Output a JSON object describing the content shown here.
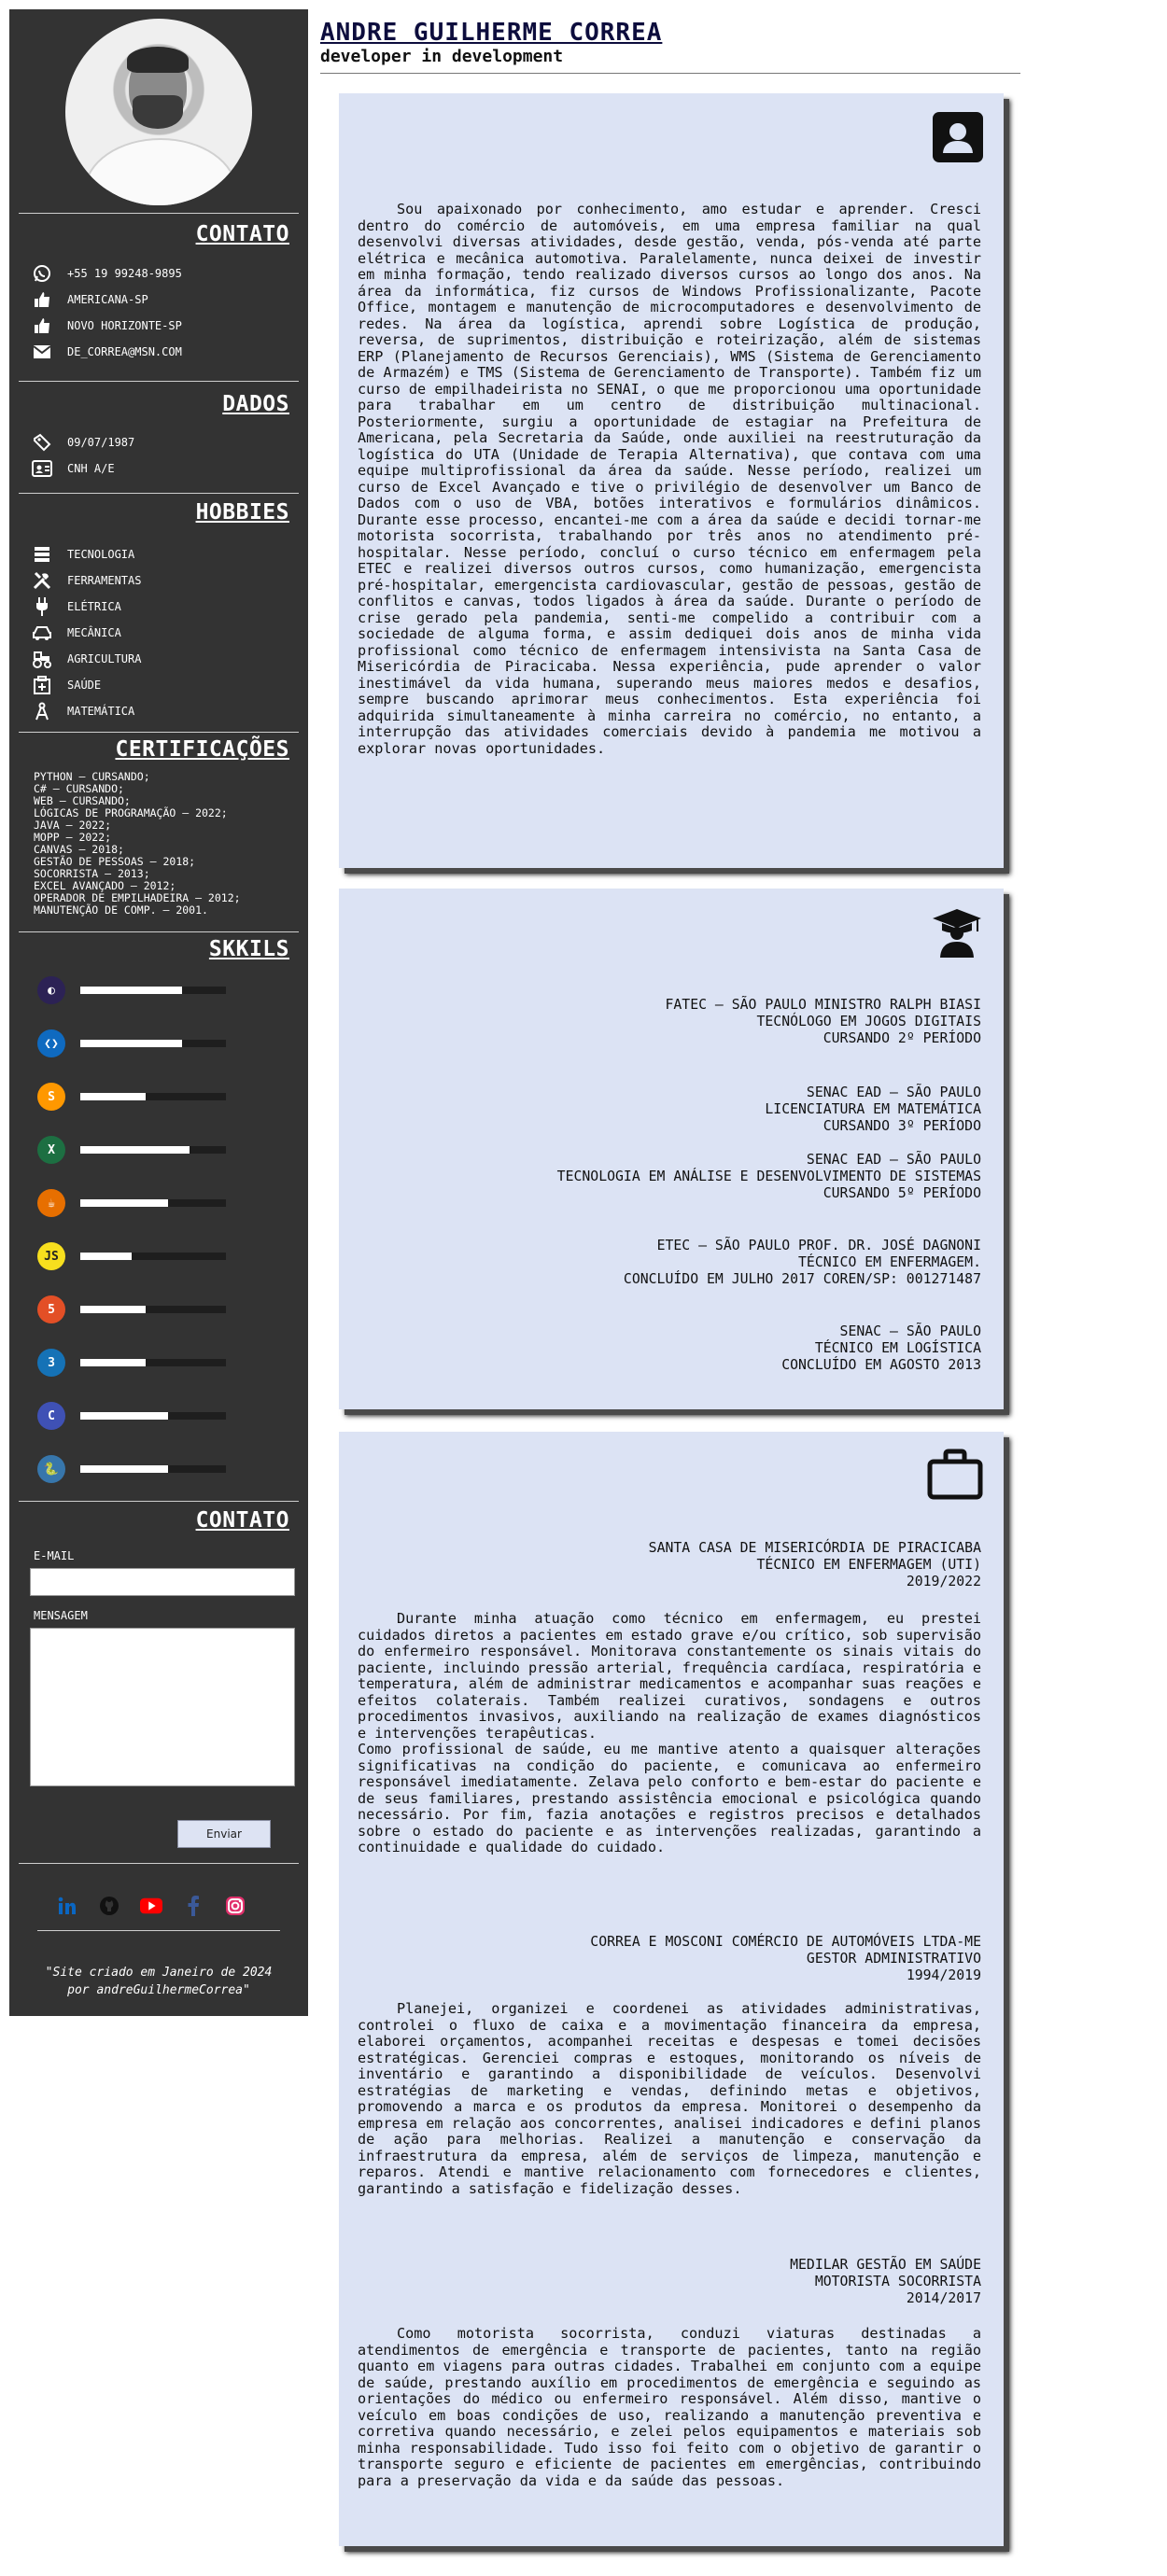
{
  "header": {
    "name": "ANDRE GUILHERME CORREA",
    "tagline": "developer in development"
  },
  "sidebar": {
    "contact": {
      "title": "CONTATO",
      "items": [
        {
          "icon": "whatsapp-icon",
          "text": "+55 19 99248-9895"
        },
        {
          "icon": "thumbs-up-icon",
          "text": "AMERICANA-SP"
        },
        {
          "icon": "thumbs-up-icon",
          "text": "NOVO HORIZONTE-SP"
        },
        {
          "icon": "envelope-icon",
          "text": "DE_CORREA@MSN.COM"
        }
      ]
    },
    "data": {
      "title": "DADOS",
      "items": [
        {
          "icon": "id-tag-icon",
          "text": "09/07/1987"
        },
        {
          "icon": "id-card-icon",
          "text": "CNH A/E"
        }
      ]
    },
    "hobbies": {
      "title": "HOBBIES",
      "items": [
        {
          "icon": "server-icon",
          "text": "TECNOLOGIA"
        },
        {
          "icon": "tools-icon",
          "text": "FERRAMENTAS"
        },
        {
          "icon": "plug-icon",
          "text": "ELÉTRICA"
        },
        {
          "icon": "car-icon",
          "text": "MECÂNICA"
        },
        {
          "icon": "tractor-icon",
          "text": "AGRICULTURA"
        },
        {
          "icon": "medkit-icon",
          "text": "SAÚDE"
        },
        {
          "icon": "compass-icon",
          "text": "MATEMÁTICA"
        }
      ]
    },
    "certifications": {
      "title": "CERTIFICAÇÕES",
      "items": [
        "PYTHON – CURSANDO;",
        "C# – CURSANDO;",
        "WEB – CURSANDO;",
        "LÓGICAS DE PROGRAMAÇÃO – 2022;",
        "JAVA – 2022;",
        "MOPP – 2022;",
        "CANVAS – 2018;",
        "GESTÃO DE PESSOAS – 2018;",
        "SOCORRISTA – 2013;",
        "EXCEL AVANÇADO – 2012;",
        "OPERADOR DE EMPILHADEIRA – 2012;",
        "MANUTENÇÃO DE COMP. – 2001."
      ]
    },
    "skills": {
      "title": "SKKILS",
      "items": [
        {
          "icon": "eclipse-icon",
          "level": 0.7,
          "color": "#2c2255"
        },
        {
          "icon": "vscode-icon",
          "level": 0.7,
          "color": "#0f6ac0"
        },
        {
          "icon": "sublime-icon",
          "level": 0.45,
          "color": "#ff9800"
        },
        {
          "icon": "excel-icon",
          "level": 0.75,
          "color": "#1d6f42"
        },
        {
          "icon": "java-icon",
          "level": 0.6,
          "color": "#e76f00"
        },
        {
          "icon": "javascript-icon",
          "level": 0.35,
          "color": "#f7df1e"
        },
        {
          "icon": "html5-icon",
          "level": 0.45,
          "color": "#e34f26"
        },
        {
          "icon": "css3-icon",
          "level": 0.45,
          "color": "#1572b6"
        },
        {
          "icon": "c-language-icon",
          "level": 0.6,
          "color": "#3f51b5"
        },
        {
          "icon": "python-icon",
          "level": 0.6,
          "color": "#3776ab"
        }
      ]
    },
    "form": {
      "title": "CONTATO",
      "email_label": "E-MAIL",
      "message_label": "MENSAGEM",
      "submit": "Enviar"
    },
    "socials": [
      {
        "icon": "linkedin-icon",
        "color": "#0a66c2"
      },
      {
        "icon": "github-icon",
        "color": "#111111"
      },
      {
        "icon": "youtube-icon",
        "color": "#ff0000"
      },
      {
        "icon": "facebook-icon",
        "color": "#3b5998"
      },
      {
        "icon": "instagram-icon",
        "color": "#e1306c"
      }
    ],
    "credit": {
      "line1": "\"Site criado em Janeiro de 2024",
      "line2": "por andreGuilhermeCorrea\""
    }
  },
  "about": {
    "text": "Sou apaixonado por conhecimento, amo estudar e aprender. Cresci dentro do comércio de automóveis, em uma empresa familiar na qual desenvolvi diversas atividades, desde gestão, venda, pós-venda até parte elétrica e mecânica automotiva. Paralelamente, nunca deixei de investir em minha formação, tendo realizado diversos cursos ao longo dos anos. Na área da informática, fiz cursos de Windows Profissionalizante, Pacote Office, montagem e manutenção de microcomputadores e desenvolvimento de redes. Na área da logística, aprendi sobre Logística de produção, reversa, de suprimentos, distribuição e roteirização, além de sistemas ERP (Planejamento de Recursos Gerenciais), WMS (Sistema de Gerenciamento de Armazém) e TMS (Sistema de Gerenciamento de Transporte). Também fiz um curso de empilhadeirista no SENAI, o que me proporcionou uma oportunidade para trabalhar em um centro de distribuição multinacional. Posteriormente, surgiu a oportunidade de estagiar na Prefeitura de Americana, pela Secretaria da Saúde, onde auxiliei na reestruturação da logística do UTA (Unidade de Terapia Alternativa), que contava com uma equipe multiprofissional da área da saúde. Nesse período, realizei um curso de Excel Avançado e tive o privilégio de desenvolver um Banco de Dados com o uso de VBA, botões interativos e formulários dinâmicos. Durante esse processo, encantei-me com a área da saúde e decidi tornar-me motorista socorrista, trabalhando por três anos no atendimento pré-hospitalar. Nesse período, concluí o curso técnico em enfermagem pela ETEC e realizei diversos outros cursos, como humanização, emergencista pré-hospitalar, emergencista cardiovascular, gestão de pessoas, gestão de conflitos e canvas, todos ligados à área da saúde. Durante o período de crise gerado pela pandemia, senti-me compelido a contribuir com a sociedade de alguma forma, e assim dediquei dois anos de minha vida profissional como técnico de enfermagem intensivista na Santa Casa de Misericórdia de Piracicaba. Nessa experiência, pude aprender o valor inestimável da vida humana, superando meus maiores medos e desafios, sempre buscando aprimorar meus conhecimentos. Esta experiência foi adquirida simultaneamente à minha carreira no comércio, no entanto, a interrupção das atividades comerciais devido à pandemia me motivou a explorar novas oportunidades."
  },
  "education": [
    {
      "lines": [
        "FATEC – SÃO PAULO MINISTRO RALPH BIASI",
        "TECNÓLOGO EM JOGOS DIGITAIS",
        "CURSANDO 2º PERÍODO"
      ]
    },
    {
      "lines": [
        "SENAC EAD – SÃO PAULO",
        "LICENCIATURA EM MATEMÁTICA",
        "CURSANDO 3º PERÍODO"
      ]
    },
    {
      "lines": [
        "SENAC EAD – SÃO PAULO",
        "TECNOLOGIA EM ANÁLISE E DESENVOLVIMENTO DE SISTEMAS",
        "CURSANDO 5º PERÍODO"
      ]
    },
    {
      "lines": [
        "ETEC – SÃO PAULO PROF. DR. JOSÉ DAGNONI",
        "TÉCNICO EM ENFERMAGEM.",
        "CONCLUÍDO EM JULHO 2017 COREN/SP: 001271487"
      ]
    },
    {
      "lines": [
        "SENAC – SÃO PAULO",
        "TÉCNICO EM LOGÍSTICA",
        "CONCLUÍDO EM AGOSTO 2013"
      ]
    }
  ],
  "experience": [
    {
      "company": "SANTA CASA DE MISERICÓRDIA DE PIRACICABA",
      "role": "TÉCNICO EM ENFERMAGEM (UTI)",
      "period": "2019/2022",
      "p1": "Durante minha atuação como técnico em enfermagem, eu prestei cuidados diretos a pacientes em estado grave e/ou crítico, sob supervisão do enfermeiro responsável. Monitorava constantemente os sinais vitais do paciente, incluindo pressão arterial, frequência cardíaca, respiratória e temperatura, além de administrar medicamentos e acompanhar suas reações e efeitos colaterais. Também realizei curativos, sondagens e outros procedimentos invasivos, auxiliando na realização de exames diagnósticos e intervenções terapêuticas.",
      "p2": "Como profissional de saúde, eu me mantive atento a quaisquer alterações significativas na condição do paciente, e comunicava ao enfermeiro responsável imediatamente. Zelava pelo conforto e bem-estar do paciente e de seus familiares, prestando assistência emocional e psicológica quando necessário. Por fim, fazia anotações e registros precisos e detalhados sobre o estado do paciente e as intervenções realizadas, garantindo a continuidade e qualidade do cuidado."
    },
    {
      "company": "CORREA E MOSCONI COMÉRCIO DE AUTOMÓVEIS LTDA-ME",
      "role": "GESTOR ADMINISTRATIVO",
      "period": "1994/2019",
      "p1": "Planejei, organizei e coordenei as atividades administrativas, controlei o fluxo de caixa e a movimentação financeira da empresa, elaborei orçamentos, acompanhei receitas e despesas e tomei decisões estratégicas. Gerenciei compras e estoques, monitorando os níveis de inventário e garantindo a disponibilidade de veículos. Desenvolvi estratégias de marketing e vendas, definindo metas e objetivos, promovendo a marca e os produtos da empresa. Monitorei o desempenho da empresa em relação aos concorrentes, analisei indicadores e defini planos de ação para melhorias. Realizei a manutenção e conservação da infraestrutura da empresa, além de serviços de limpeza, manutenção e reparos. Atendi e mantive relacionamento com fornecedores e clientes, garantindo a satisfação e fidelização desses."
    },
    {
      "company": "MEDILAR GESTÃO EM SAÚDE",
      "role": "MOTORISTA SOCORRISTA",
      "period": "2014/2017",
      "p1": "Como motorista socorrista, conduzi viaturas destinadas a atendimentos de emergência e transporte de pacientes, tanto na região quanto em viagens para outras cidades. Trabalhei em conjunto com a equipe de saúde, prestando auxílio em procedimentos de emergência e seguindo as orientações do médico ou enfermeiro responsável. Além disso, mantive o veículo em boas condições de uso, realizando a manutenção preventiva e corretiva quando necessário, e zelei pelos equipamentos e materiais sob minha responsabilidade. Tudo isso foi feito com o objetivo de garantir o transporte seguro e eficiente de pacientes em emergências, contribuindo para a preservação da vida e da saúde das pessoas."
    }
  ]
}
